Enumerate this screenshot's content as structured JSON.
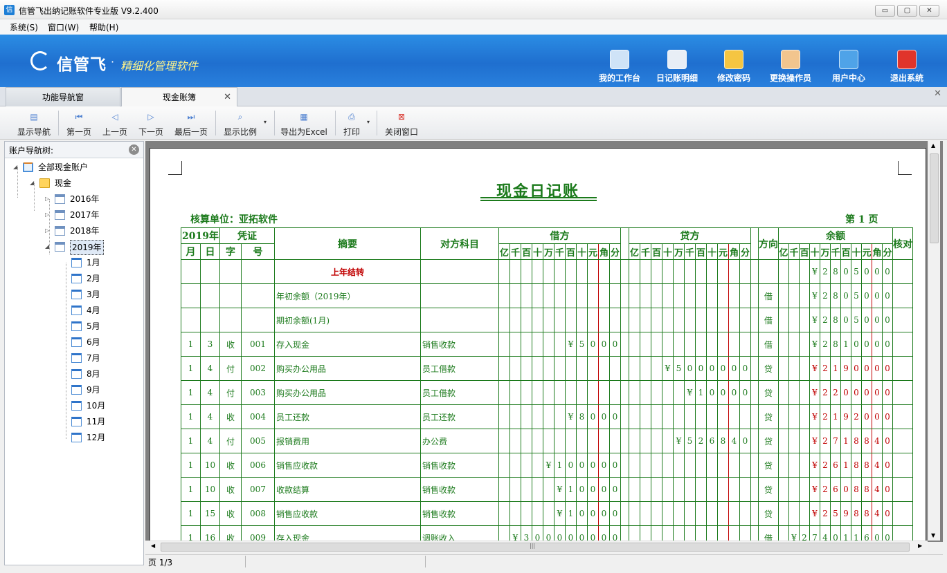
{
  "window": {
    "title": "信管飞出纳记账软件专业版 V9.2.400",
    "icon_text": "信",
    "minimize": "▭",
    "maximize": "▢",
    "close": "✕"
  },
  "menubar": [
    "系统(S)",
    "窗口(W)",
    "帮助(H)"
  ],
  "banner": {
    "logo": "信管飞",
    "dot": "·",
    "slogan": "精细化管理软件",
    "buttons": [
      {
        "label": "我的工作台",
        "icon": "monitor-icon",
        "color": "#cfe3f7"
      },
      {
        "label": "日记账明细",
        "icon": "ledger-icon",
        "color": "#e8eef6"
      },
      {
        "label": "修改密码",
        "icon": "lock-icon",
        "color": "#f5c542"
      },
      {
        "label": "更换操作员",
        "icon": "user-icon",
        "color": "#f2c58e"
      },
      {
        "label": "用户中心",
        "icon": "globe-icon",
        "color": "#4fa3e8"
      },
      {
        "label": "退出系统",
        "icon": "power-icon",
        "color": "#e0342b"
      }
    ]
  },
  "tabs": [
    {
      "label": "功能导航窗"
    },
    {
      "label": "现金账簿",
      "close": "✕"
    }
  ],
  "tabstrip_close": "✕",
  "toolbar": {
    "show_nav": "显示导航",
    "first": "第一页",
    "prev": "上一页",
    "next": "下一页",
    "last": "最后一页",
    "zoom": "显示比例",
    "export": "导出为Excel",
    "print": "打印",
    "close": "关闭窗口",
    "caret": "▾"
  },
  "nav": {
    "title": "账户导航树:",
    "close": "✕",
    "root": "全部现金账户",
    "folder": "现金",
    "years": [
      "2016年",
      "2017年",
      "2018年",
      "2019年"
    ],
    "months": [
      "1月",
      "2月",
      "3月",
      "4月",
      "5月",
      "6月",
      "7月",
      "8月",
      "9月",
      "10月",
      "11月",
      "12月"
    ],
    "expander_closed": "▷",
    "expander_open": "◢"
  },
  "doc": {
    "title": "现金日记账",
    "unit_label": "核算单位：亚拓软件",
    "page_label": "第 1 页",
    "head": {
      "year": "2019年",
      "voucher": "凭证",
      "summary": "摘要",
      "account": "对方科目",
      "debit": "借方",
      "credit": "贷方",
      "direction": "方向",
      "balance": "余额",
      "check": "核对",
      "month": "月",
      "day": "日",
      "zi": "字",
      "hao": "号",
      "digits": [
        "亿",
        "千",
        "百",
        "十",
        "万",
        "千",
        "百",
        "十",
        "元",
        "角",
        "分"
      ]
    },
    "rows": [
      {
        "m": "",
        "d": "",
        "z": "",
        "h": "",
        "summary": "上年结转",
        "summary_style": "carry",
        "acct": "",
        "debit": "",
        "credit": "",
        "dir": "",
        "bal": "¥2805000",
        "bal_red": false
      },
      {
        "m": "",
        "d": "",
        "z": "",
        "h": "",
        "summary": "年初余额（2019年）",
        "summary_style": "",
        "acct": "",
        "debit": "",
        "credit": "",
        "dir": "借",
        "bal": "¥2805000",
        "bal_red": false
      },
      {
        "m": "",
        "d": "",
        "z": "",
        "h": "",
        "summary": "期初余额(1月)",
        "summary_style": "",
        "acct": "",
        "debit": "",
        "credit": "",
        "dir": "借",
        "bal": "¥2805000",
        "bal_red": false
      },
      {
        "m": "1",
        "d": "3",
        "z": "收",
        "h": "001",
        "summary": "存入现金",
        "summary_style": "",
        "acct": "销售收款",
        "debit": "¥5000",
        "credit": "",
        "dir": "借",
        "bal": "¥2810000",
        "bal_red": false
      },
      {
        "m": "1",
        "d": "4",
        "z": "付",
        "h": "002",
        "summary": "购买办公用品",
        "summary_style": "",
        "acct": "员工借款",
        "debit": "",
        "credit": "¥5000000",
        "dir": "贷",
        "bal": "¥2190000",
        "bal_red": true
      },
      {
        "m": "1",
        "d": "4",
        "z": "付",
        "h": "003",
        "summary": "购买办公用品",
        "summary_style": "",
        "acct": "员工借款",
        "debit": "",
        "credit": "¥10000",
        "dir": "贷",
        "bal": "¥2200000",
        "bal_red": true
      },
      {
        "m": "1",
        "d": "4",
        "z": "收",
        "h": "004",
        "summary": "员工还款",
        "summary_style": "",
        "acct": "员工还款",
        "debit": "¥8000",
        "credit": "",
        "dir": "贷",
        "bal": "¥2192000",
        "bal_red": true
      },
      {
        "m": "1",
        "d": "4",
        "z": "付",
        "h": "005",
        "summary": "报销费用",
        "summary_style": "",
        "acct": "办公费",
        "debit": "",
        "credit": "¥526840",
        "dir": "贷",
        "bal": "¥2718840",
        "bal_red": true
      },
      {
        "m": "1",
        "d": "10",
        "z": "收",
        "h": "006",
        "summary": "销售应收款",
        "summary_style": "",
        "acct": "销售收款",
        "debit": "¥100000",
        "credit": "",
        "dir": "贷",
        "bal": "¥2618840",
        "bal_red": true
      },
      {
        "m": "1",
        "d": "10",
        "z": "收",
        "h": "007",
        "summary": "收款结算",
        "summary_style": "",
        "acct": "销售收款",
        "debit": "¥10000",
        "credit": "",
        "dir": "贷",
        "bal": "¥2608840",
        "bal_red": true
      },
      {
        "m": "1",
        "d": "15",
        "z": "收",
        "h": "008",
        "summary": "销售应收款",
        "summary_style": "",
        "acct": "销售收款",
        "debit": "¥10000",
        "credit": "",
        "dir": "贷",
        "bal": "¥2598840",
        "bal_red": true
      },
      {
        "m": "1",
        "d": "16",
        "z": "收",
        "h": "009",
        "summary": "存入现金",
        "summary_style": "",
        "acct": "调账收入",
        "debit": "¥300000000",
        "credit": "",
        "dir": "借",
        "bal": "¥274011600",
        "bal_red": false
      }
    ]
  },
  "scroll": {
    "up": "▲",
    "down": "▼",
    "left": "◀",
    "right": "▶",
    "grip": "|||"
  },
  "status": {
    "page": "页 1/3"
  },
  "colors": {
    "ledger_green": "#1b7a1b",
    "ledger_red": "#c00000",
    "banner_blue": "#1f6fcf"
  }
}
